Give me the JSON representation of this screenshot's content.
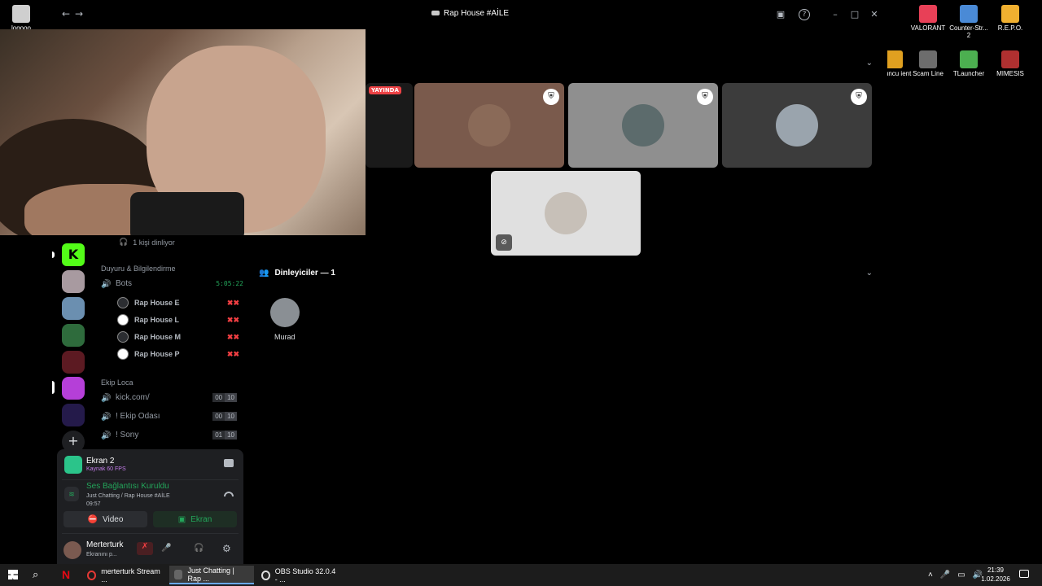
{
  "window": {
    "title": "Rap House #AİLE",
    "back_icon": "←",
    "forward_icon": "→",
    "inbox_icon": "▣",
    "help_icon": "?",
    "min_icon": "–",
    "max_icon": "□",
    "close_icon": "✕"
  },
  "desktop_icons": [
    {
      "label": "logooo",
      "color": "#cfcfcf"
    },
    {
      "label": "VALORANT",
      "color": "#e84057"
    },
    {
      "label": "Counter-Str... 2",
      "color": "#4a8ad6"
    },
    {
      "label": "R.E.P.O.",
      "color": "#f0b030"
    },
    {
      "label": "Oyuncu ient",
      "color": "#e0a020"
    },
    {
      "label": "Scam Line",
      "color": "#6d6d6d"
    },
    {
      "label": "TLauncher",
      "color": "#4caf50"
    },
    {
      "label": "MIMESIS",
      "color": "#b03030"
    }
  ],
  "channels": {
    "listening_text": "1 kişi dinliyor",
    "category_announce": "Duyuru & Bilgilendirme",
    "bots_channel": {
      "name": "Bots",
      "time": "5:05:22"
    },
    "bots": [
      "Rap House E",
      "Rap House L",
      "Rap House M",
      "Rap House P"
    ],
    "category_team": "Ekip Loca",
    "team_channels": [
      {
        "name": "kick.com/",
        "a": "00",
        "b": "10"
      },
      {
        "name": "! Ekip Odası",
        "a": "00",
        "b": "10"
      },
      {
        "name": "! Sony",
        "a": "01",
        "b": "10"
      }
    ]
  },
  "stream_panel": {
    "screen_title": "Ekran 2",
    "screen_sub": "Kaynak 60 FPS",
    "connected": "Ses Bağlantısı Kuruldu",
    "location": "Just Chatting / Rap House #AİLE",
    "elapsed": "09:57",
    "video_label": "Video",
    "screen_label": "Ekran"
  },
  "user": {
    "name": "Merterturk",
    "status": "Ekranını p..."
  },
  "stage": {
    "live_badge": "YAYINDA",
    "listeners_header": "Dinleyiciler — 1",
    "listener_name": "Murad"
  },
  "taskbar": {
    "items": [
      "merterturk Stream ...",
      "Just Chatting | Rap ...",
      "OBS Studio 32.0.4 - ..."
    ],
    "time": "21:39",
    "date": "1.02.2026"
  },
  "colors": {
    "accent_green": "#23a55a",
    "live_red": "#ed4245",
    "discord_dark": "#1e1f22"
  }
}
